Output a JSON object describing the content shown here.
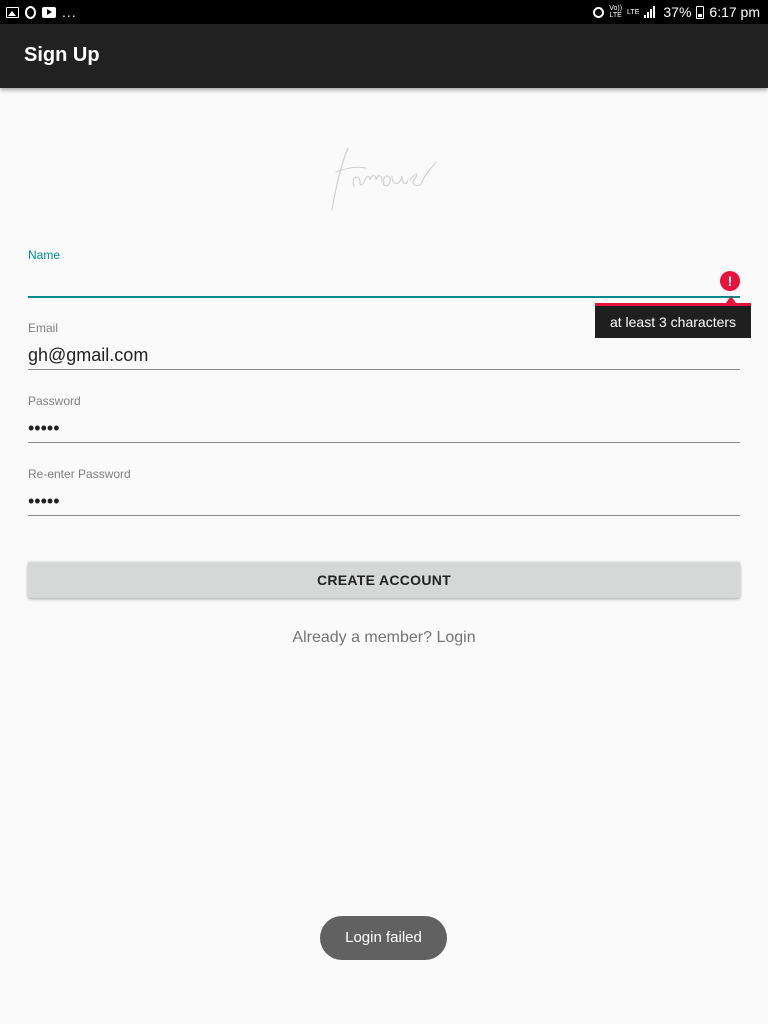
{
  "status_bar": {
    "left_icons": [
      "image-icon",
      "opera-icon",
      "youtube-icon"
    ],
    "overflow": "...",
    "volte_top": "Vo))",
    "volte_bottom": "LTE",
    "lte_label": "LTE",
    "battery_percent": "37%",
    "time": "6:17 pm"
  },
  "app_bar": {
    "title": "Sign Up"
  },
  "logo": {
    "text": "famous"
  },
  "form": {
    "name": {
      "label": "Name",
      "value": "",
      "error": "at least 3 characters"
    },
    "email": {
      "label": "Email",
      "value": "gh@gmail.com"
    },
    "password": {
      "label": "Password",
      "value": "•••••"
    },
    "reenter_password": {
      "label": "Re-enter Password",
      "value": "•••••"
    }
  },
  "create_button": {
    "label": "CREATE ACCOUNT"
  },
  "login_link": {
    "label": "Already a member? Login"
  },
  "toast": {
    "message": "Login failed"
  },
  "colors": {
    "accent": "#008c8c",
    "error": "#e8103c",
    "app_bar": "#212121",
    "button": "#d6d7d7"
  }
}
